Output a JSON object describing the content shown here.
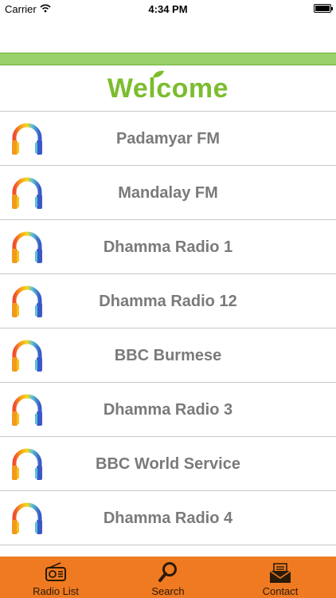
{
  "status_bar": {
    "carrier": "Carrier",
    "time": "4:34 PM"
  },
  "header": {
    "welcome": "Welcome",
    "accent_color": "#7bbd2e"
  },
  "stations": [
    {
      "name": "Padamyar FM",
      "icon": "headphones-icon"
    },
    {
      "name": "Mandalay FM",
      "icon": "headphones-icon"
    },
    {
      "name": "Dhamma Radio 1",
      "icon": "headphones-icon"
    },
    {
      "name": "Dhamma Radio 12",
      "icon": "headphones-icon"
    },
    {
      "name": "BBC Burmese",
      "icon": "headphones-icon"
    },
    {
      "name": "Dhamma Radio 3",
      "icon": "headphones-icon"
    },
    {
      "name": "BBC World Service",
      "icon": "headphones-icon"
    },
    {
      "name": "Dhamma Radio 4",
      "icon": "headphones-icon"
    }
  ],
  "tabbar": {
    "background": "#ef7a21",
    "tabs": [
      {
        "label": "Radio List",
        "icon": "radio-icon"
      },
      {
        "label": "Search",
        "icon": "search-icon"
      },
      {
        "label": "Contact",
        "icon": "envelope-icon"
      }
    ]
  }
}
